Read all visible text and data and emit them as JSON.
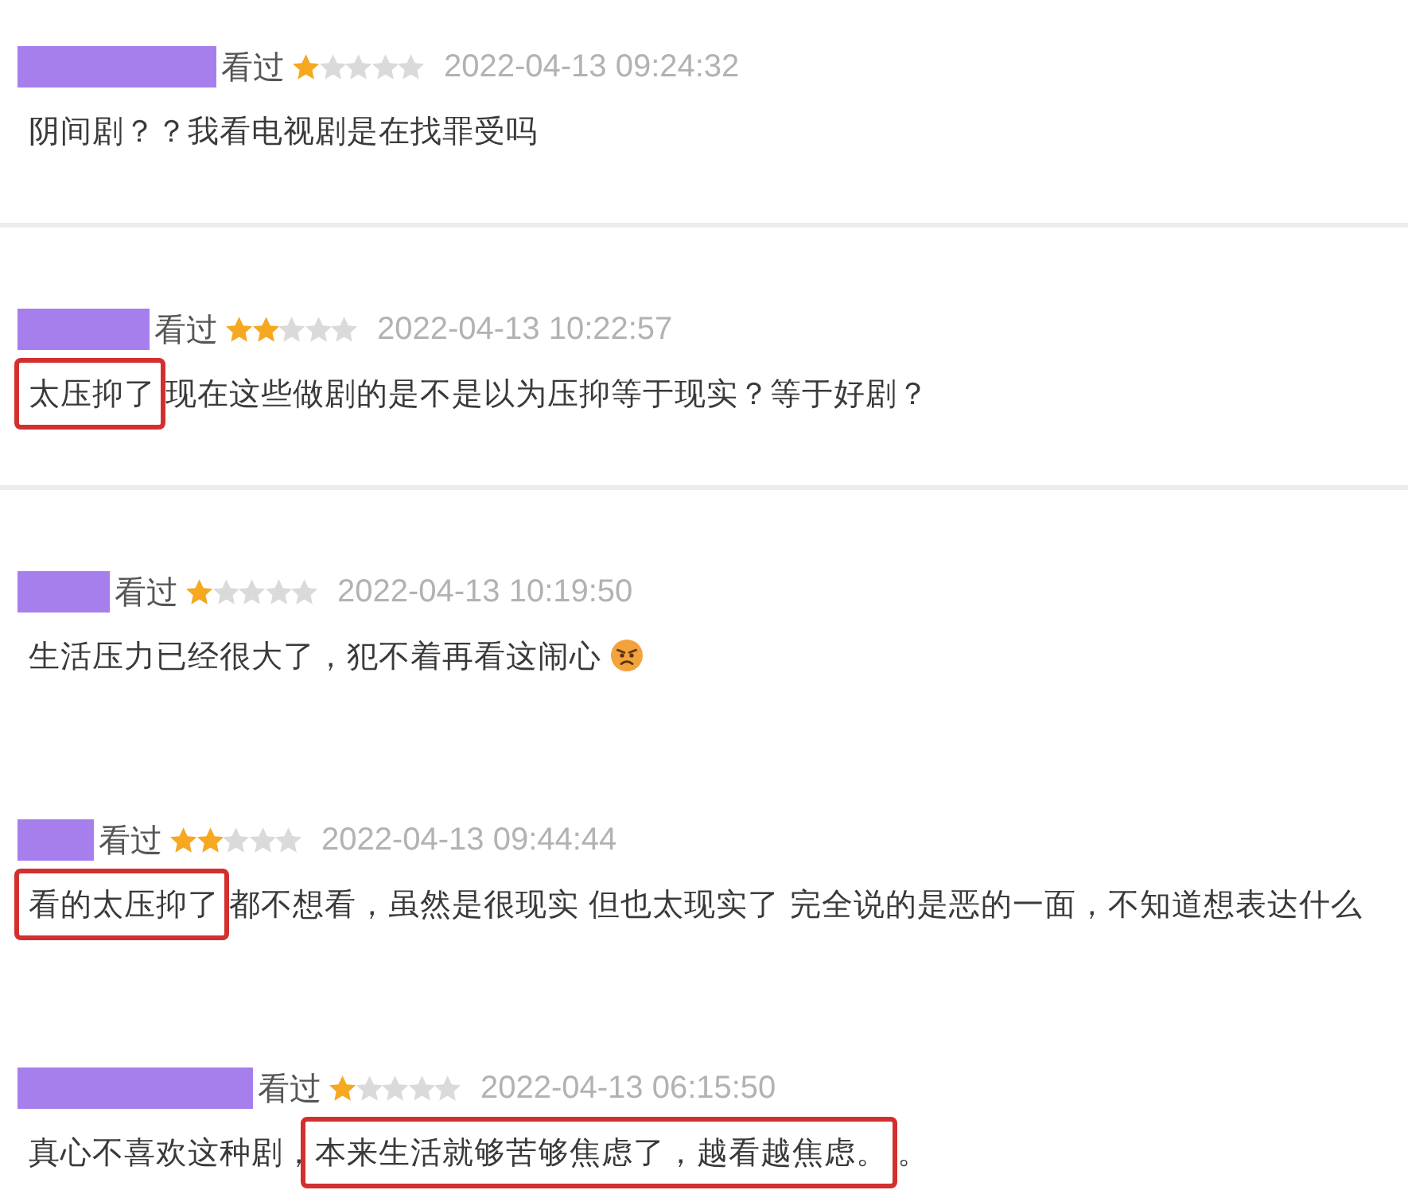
{
  "reviews": [
    {
      "status": "看过",
      "stars": 1,
      "time": "2022-04-13 09:24:32",
      "comment": [
        {
          "kind": "text",
          "text": "阴间剧？？我看电视剧是在找罪受吗",
          "highlighted": false
        }
      ],
      "divider_below": true
    },
    {
      "status": "看过",
      "stars": 2,
      "time": "2022-04-13 10:22:57",
      "comment": [
        {
          "kind": "text",
          "text": "太压抑了",
          "highlighted": true
        },
        {
          "kind": "text",
          "text": "现在这些做剧的是不是以为压抑等于现实？等于好剧？",
          "highlighted": false
        }
      ],
      "divider_below": true
    },
    {
      "status": "看过",
      "stars": 1,
      "time": "2022-04-13 10:19:50",
      "comment": [
        {
          "kind": "text",
          "text": "生活压力已经很大了，犯不着再看这闹心",
          "highlighted": false
        },
        {
          "kind": "emoji"
        }
      ],
      "divider_below": false
    },
    {
      "status": "看过",
      "stars": 2,
      "time": "2022-04-13 09:44:44",
      "comment": [
        {
          "kind": "text",
          "text": "看的太压抑了",
          "highlighted": true
        },
        {
          "kind": "text",
          "text": "都不想看，虽然是很现实 但也太现实了 完全说的是恶的一面，不知道想表达什么",
          "highlighted": false
        }
      ],
      "divider_below": false
    },
    {
      "status": "看过",
      "stars": 1,
      "time": "2022-04-13 06:15:50",
      "comment": [
        {
          "kind": "text",
          "text": "真心不喜欢这种剧，",
          "highlighted": false
        },
        {
          "kind": "text",
          "text": "本来生活就够苦够焦虑了，越看越焦虑。",
          "highlighted": true
        },
        {
          "kind": "text",
          "text": "。",
          "highlighted": false
        }
      ],
      "divider_below": false
    }
  ]
}
